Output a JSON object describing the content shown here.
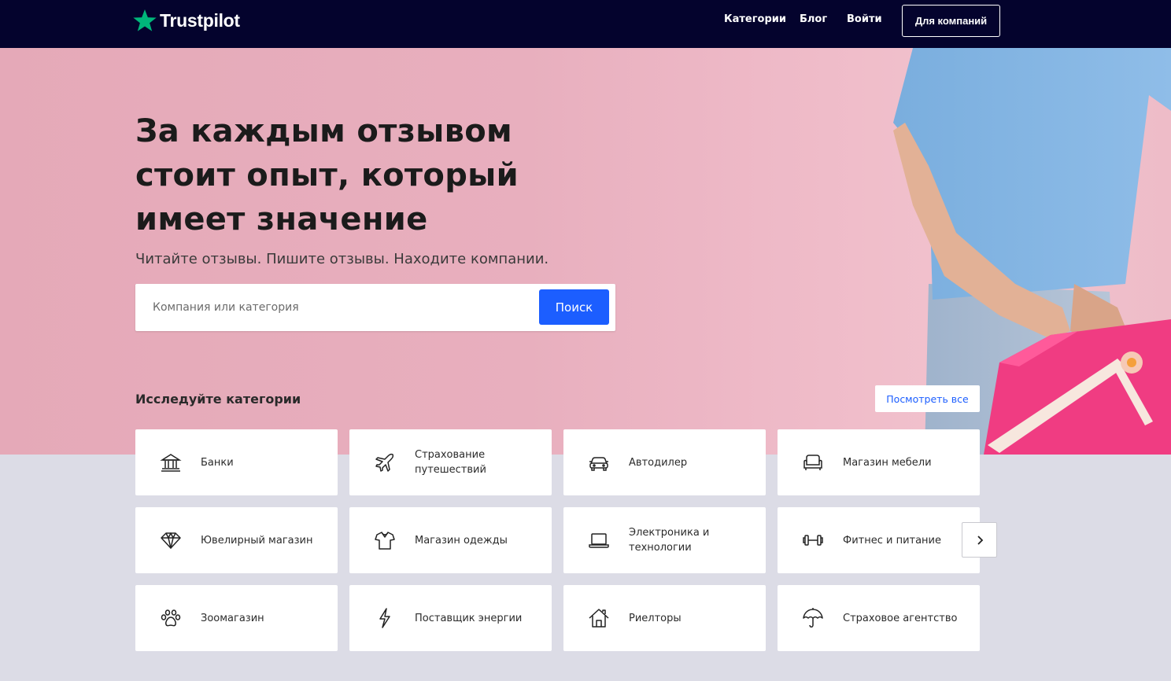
{
  "brand": {
    "name": "Trustpilot",
    "star_color": "#00b67a"
  },
  "nav": {
    "categories": "Категории",
    "blog": "Блог",
    "login": "Войти",
    "business": "Для компаний"
  },
  "hero": {
    "headline": "За каждым отзывом стоит опыт, который имеет значение",
    "subline": "Читайте отзывы. Пишите отзывы. Находите компании.",
    "search_placeholder": "Компания или категория",
    "search_button": "Поиск",
    "explore_title": "Исследуйте категории",
    "see_all": "Посмотреть все"
  },
  "colors": {
    "header_bg": "#04032d",
    "accent_blue": "#1c5eff",
    "hero_pink": "#e8afbe",
    "page_bg": "#dcdce6"
  },
  "categories": [
    {
      "label": "Банки",
      "icon": "bank-icon"
    },
    {
      "label": "Страхование путешествий",
      "icon": "airplane-icon"
    },
    {
      "label": "Автодилер",
      "icon": "car-icon"
    },
    {
      "label": "Магазин мебели",
      "icon": "armchair-icon"
    },
    {
      "label": "Ювелирный магазин",
      "icon": "diamond-icon"
    },
    {
      "label": "Магазин одежды",
      "icon": "shirt-icon"
    },
    {
      "label": "Электроника и технологии",
      "icon": "laptop-icon"
    },
    {
      "label": "Фитнес и питание",
      "icon": "dumbbell-icon"
    },
    {
      "label": "Зоомагазин",
      "icon": "paw-icon"
    },
    {
      "label": "Поставщик энергии",
      "icon": "lightning-icon"
    },
    {
      "label": "Риелторы",
      "icon": "house-icon"
    },
    {
      "label": "Страховое агентство",
      "icon": "umbrella-icon"
    }
  ],
  "carousel": {
    "next_icon": "chevron-right-icon"
  }
}
